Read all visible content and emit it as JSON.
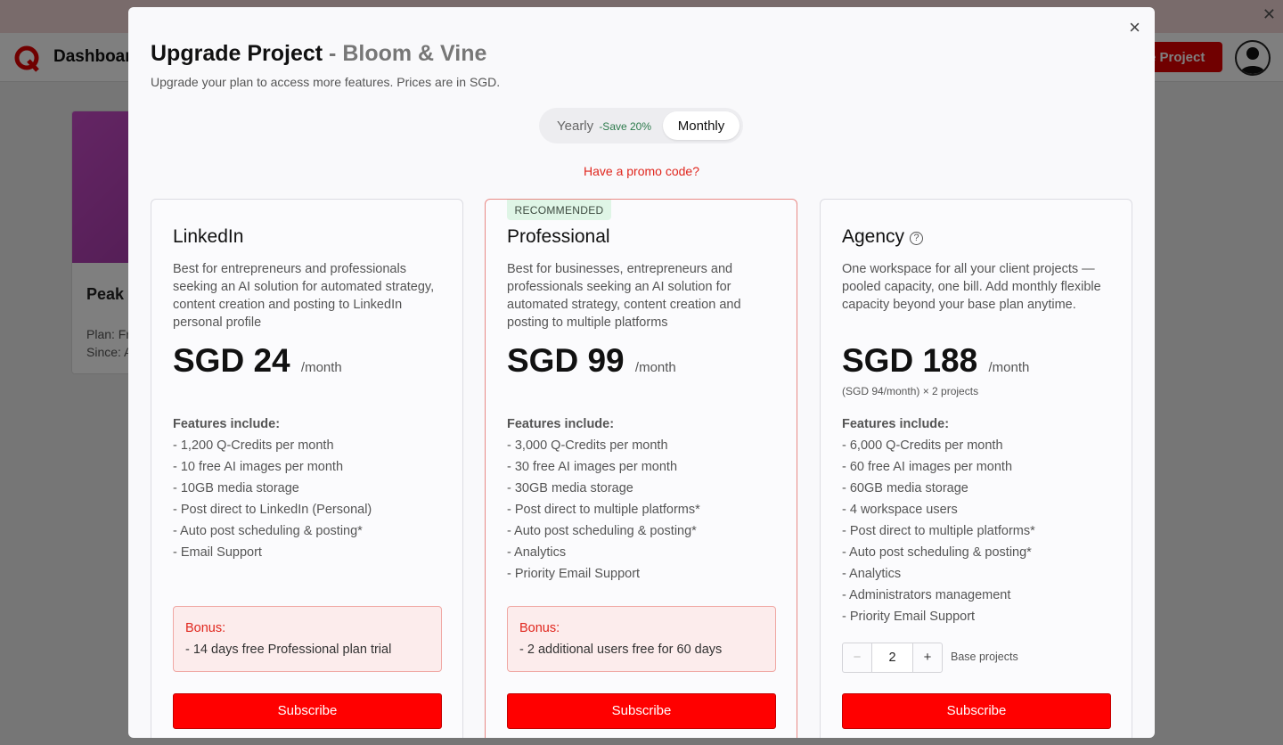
{
  "background": {
    "nav_title": "Dashboard",
    "create_button": "te Project",
    "project": {
      "name": "Peak",
      "plan": "Plan: Fr",
      "since": "Since: A"
    }
  },
  "modal": {
    "title": "Upgrade Project",
    "project_suffix": " - Bloom & Vine",
    "subtitle": "Upgrade your plan to access more features. Prices are in SGD.",
    "close_icon": "×",
    "toggle": {
      "yearly": "Yearly",
      "save": "-Save 20%",
      "monthly": "Monthly",
      "selected": "Monthly"
    },
    "promo": "Have a promo code?",
    "features_head": "Features include:",
    "bonus_title": "Bonus:",
    "subscribe": "Subscribe"
  },
  "plans": [
    {
      "name": "LinkedIn",
      "description": "Best for entrepreneurs and professionals seeking an AI solution for automated strategy, content creation and posting to LinkedIn personal profile",
      "price": "SGD 24",
      "per": "/month",
      "features": [
        "- 1,200 Q-Credits per month",
        "- 10 free AI images per month",
        "- 10GB media storage",
        "- Post direct to LinkedIn (Personal)",
        "- Auto post scheduling & posting*",
        "- Email Support"
      ],
      "bonus": "- 14 days free Professional plan trial"
    },
    {
      "badge": "RECOMMENDED",
      "name": "Professional",
      "description": "Best for businesses, entrepreneurs and professionals seeking an AI solution for automated strategy, content creation and posting to multiple platforms",
      "price": "SGD 99",
      "per": "/month",
      "features": [
        "- 3,000 Q-Credits per month",
        "- 30 free AI images per month",
        "- 30GB media storage",
        "- Post direct to multiple platforms*",
        "- Auto post scheduling & posting*",
        "- Analytics",
        "- Priority Email Support"
      ],
      "bonus": "- 2 additional users free for 60 days"
    },
    {
      "name": "Agency",
      "help_icon": "?",
      "description": "One workspace for all your client projects — pooled capacity, one bill. Add monthly flexible capacity beyond your base plan anytime.",
      "price": "SGD 188",
      "per": "/month",
      "price_note": "(SGD 94/month) × 2 projects",
      "features": [
        "- 6,000 Q-Credits per month",
        "- 60 free AI images per month",
        "- 60GB media storage",
        "- 4 workspace users",
        "- Post direct to multiple platforms*",
        "- Auto post scheduling & posting*",
        "- Analytics",
        "- Administrators management",
        "- Priority Email Support"
      ],
      "stepper": {
        "minus": "−",
        "value": "2",
        "plus": "+",
        "label": "Base projects"
      }
    }
  ],
  "colors": {
    "accent": "#ff0000",
    "promo": "#e0261d",
    "badge_bg": "#dff5e6"
  }
}
